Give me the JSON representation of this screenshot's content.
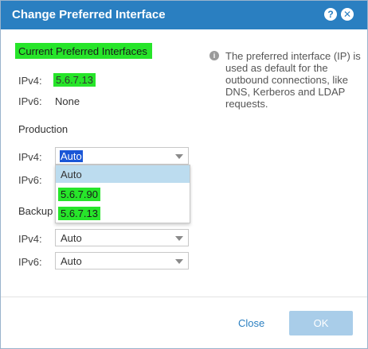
{
  "dialog": {
    "title": "Change Preferred Interface",
    "help_icon": "?",
    "close_icon": "✕"
  },
  "current": {
    "heading": "Current Preferred Interfaces",
    "ipv4_label": "IPv4:",
    "ipv4_value": "5.6.7.13",
    "ipv6_label": "IPv6:",
    "ipv6_value": "None"
  },
  "info": {
    "icon": "i",
    "text": "The preferred interface (IP) is used as default for the outbound connections, like DNS, Kerberos and LDAP requests."
  },
  "production": {
    "heading": "Production",
    "ipv4_label": "IPv4:",
    "ipv4_selected": "Auto",
    "ipv6_label": "IPv6:",
    "dropdown_options": [
      "Auto",
      "5.6.7.90",
      "5.6.7.13"
    ]
  },
  "backup": {
    "heading": "Backup",
    "ipv4_label": "IPv4:",
    "ipv4_selected": "Auto",
    "ipv6_label": "IPv6:",
    "ipv6_selected": "Auto"
  },
  "footer": {
    "close_label": "Close",
    "ok_label": "OK"
  },
  "colors": {
    "titlebar": "#2a7fc1",
    "highlight": "#27e52a",
    "ok_button_disabled": "#a9cde9",
    "selected_option": "#bcdcef"
  }
}
